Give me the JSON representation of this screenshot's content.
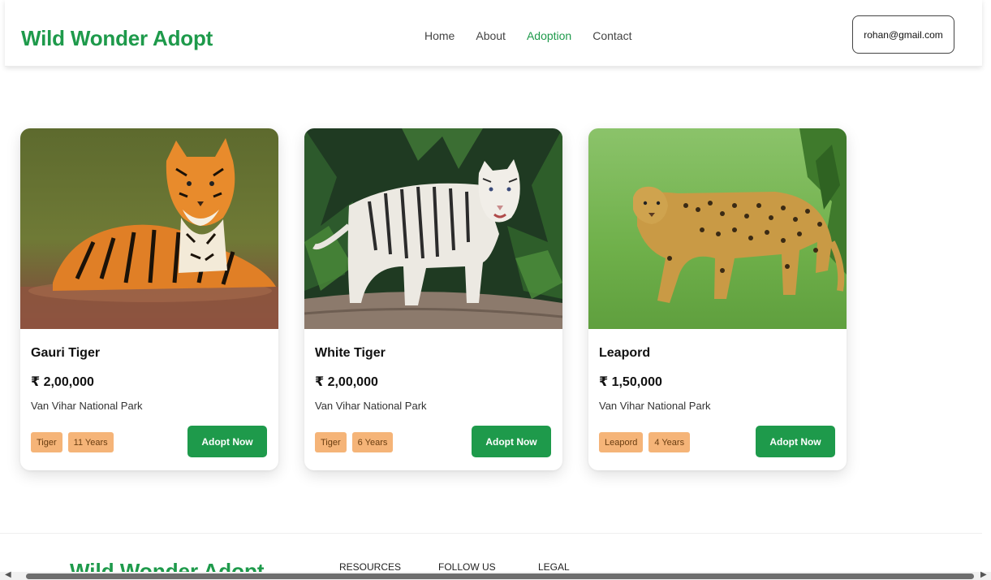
{
  "header": {
    "brand": "Wild Wonder Adopt",
    "nav": [
      "Home",
      "About",
      "Adoption",
      "Contact"
    ],
    "active_nav": "Adoption",
    "user_email": "rohan@gmail.com"
  },
  "colors": {
    "brand_green": "#1e9a4b",
    "tag_bg": "#f5b478",
    "active_nav": "#1e9a4b"
  },
  "cards": [
    {
      "name": "Gauri Tiger",
      "price": "₹ 2,00,000",
      "location": "Van Vihar National Park",
      "tags": [
        "Tiger",
        "11 Years"
      ],
      "button": "Adopt Now",
      "image": "bengal-tiger-photo"
    },
    {
      "name": "White Tiger",
      "price": "₹ 2,00,000",
      "location": "Van Vihar National Park",
      "tags": [
        "Tiger",
        "6 Years"
      ],
      "button": "Adopt Now",
      "image": "white-tiger-photo"
    },
    {
      "name": "Leapord",
      "price": "₹ 1,50,000",
      "location": "Van Vihar National Park",
      "tags": [
        "Leapord",
        "4 Years"
      ],
      "button": "Adopt Now",
      "image": "leopard-photo"
    }
  ],
  "footer": {
    "brand": "Wild Wonder Adopt",
    "columns": [
      "RESOURCES",
      "FOLLOW US",
      "LEGAL"
    ]
  }
}
